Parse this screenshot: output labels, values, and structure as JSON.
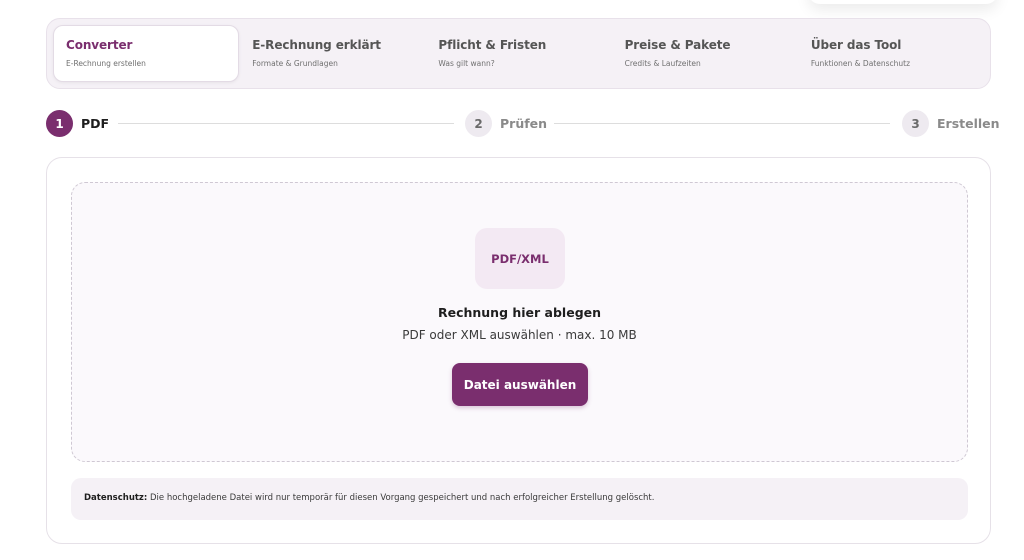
{
  "tabs": [
    {
      "title": "Converter",
      "subtitle": "E-Rechnung erstellen",
      "active": true
    },
    {
      "title": "E-Rechnung erklärt",
      "subtitle": "Formate & Grundlagen",
      "active": false
    },
    {
      "title": "Pflicht & Fristen",
      "subtitle": "Was gilt wann?",
      "active": false
    },
    {
      "title": "Preise & Pakete",
      "subtitle": "Credits & Laufzeiten",
      "active": false
    },
    {
      "title": "Über das Tool",
      "subtitle": "Funktionen & Datenschutz",
      "active": false
    }
  ],
  "steps": [
    {
      "number": "1",
      "label": "PDF",
      "active": true
    },
    {
      "number": "2",
      "label": "Prüfen",
      "active": false
    },
    {
      "number": "3",
      "label": "Erstellen",
      "active": false
    }
  ],
  "upload": {
    "badge": "PDF/XML",
    "title": "Rechnung hier ablegen",
    "subtitle": "PDF oder XML auswählen · max. 10 MB",
    "button_label": "Datei auswählen"
  },
  "privacy": {
    "label": "Datenschutz:",
    "text": " Die hochgeladene Datei wird nur temporär für diesen Vorgang gespeichert und nach erfolgreicher Erstellung gelöscht."
  },
  "colors": {
    "accent": "#7a2e6e",
    "tab_background": "#f5f1f6",
    "dropzone_background": "#fbf9fc",
    "badge_background": "#f3e9f3"
  }
}
